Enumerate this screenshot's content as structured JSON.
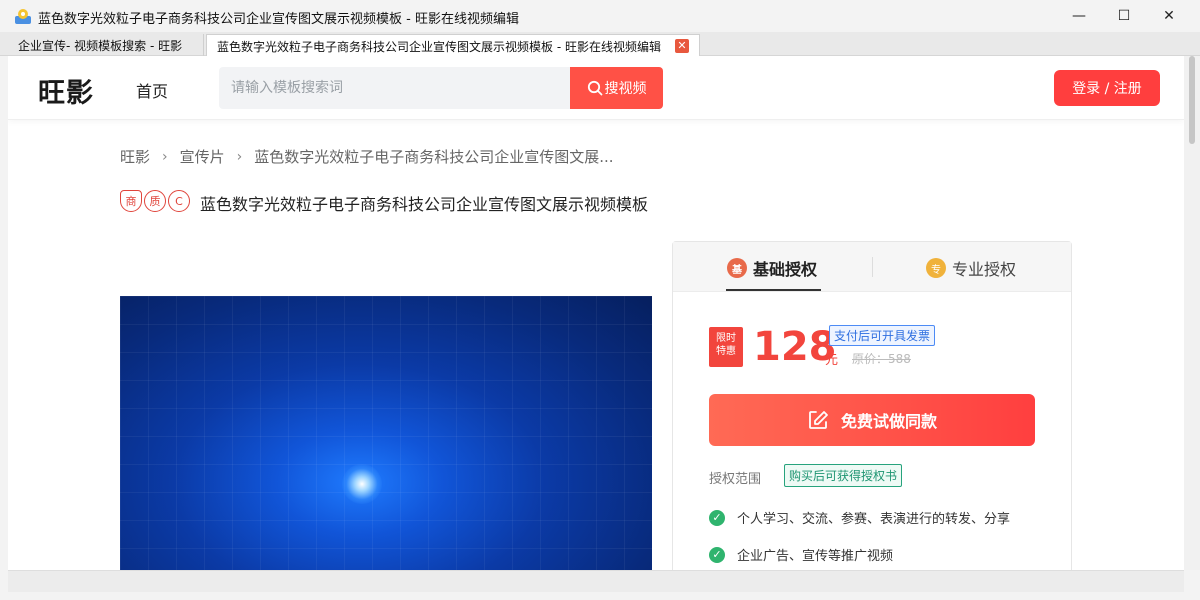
{
  "window": {
    "title": "蓝色数字光效粒子电子商务科技公司企业宣传图文展示视频模板 - 旺影在线视频编辑",
    "controls": {
      "minimize": "—",
      "maximize": "☐",
      "close": "✕"
    }
  },
  "tabs": [
    {
      "label": "企业宣传- 视频模板搜索 - 旺影"
    },
    {
      "label": "蓝色数字光效粒子电子商务科技公司企业宣传图文展示视频模板 - 旺影在线视频编辑",
      "close": "✕"
    }
  ],
  "header": {
    "logo": "旺影",
    "nav_home": "首页",
    "search": {
      "placeholder": "请输入模板搜索词",
      "button_label": "搜视频"
    },
    "login_label": "登录 / 注册"
  },
  "breadcrumb": [
    "旺影",
    "宣传片",
    "蓝色数字光效粒子电子商务科技公司企业宣传图文展..."
  ],
  "breadcrumb_separator": "›",
  "title_badges": [
    "商",
    "质",
    "C"
  ],
  "page_title": "蓝色数字光效粒子电子商务科技公司企业宣传图文展示视频模板",
  "license": {
    "tabs": [
      {
        "label": "基础授权",
        "medal": "基",
        "active": true
      },
      {
        "label": "专业授权",
        "medal": "专",
        "active": false
      }
    ],
    "limited_badge": [
      "限时",
      "特惠"
    ],
    "price": "128",
    "currency": "元",
    "invoice_tag": "支付后可开具发票",
    "original_price": "原价：588",
    "trial_button": "免费试做同款",
    "scope_label": "授权范围",
    "scope_tag": "购买后可获得授权书",
    "scope_items": [
      "个人学习、交流、参赛、表演进行的转发、分享",
      "企业广告、宣传等推广视频"
    ]
  },
  "colors": {
    "accent": "#ff4b45",
    "price": "#f2453d",
    "check": "#2fb46e",
    "video_bg": "#0b3aa6"
  },
  "icons": {
    "search": "search-icon",
    "edit": "edit-icon",
    "check": "check-circle-icon"
  }
}
